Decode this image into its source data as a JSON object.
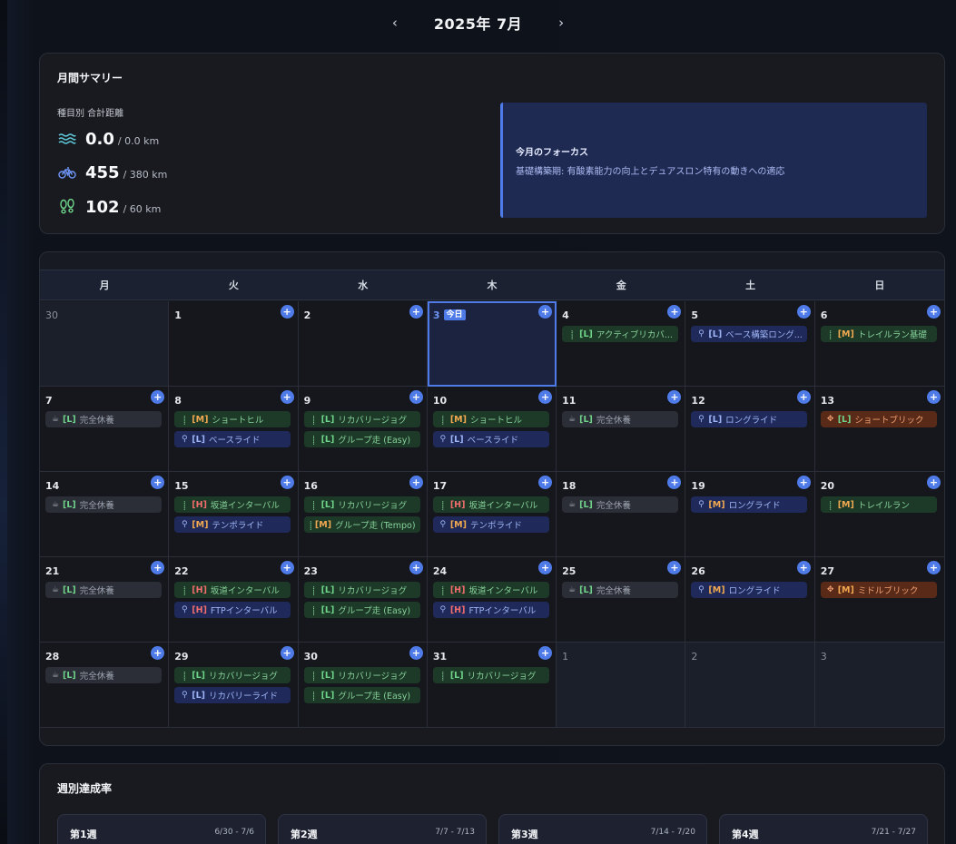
{
  "header": {
    "title": "2025年 7月",
    "prev": "‹",
    "next": "›"
  },
  "summary": {
    "title": "月間サマリー",
    "distance_label": "種目別 合計距離",
    "swim": {
      "value": "0.0",
      "target": "/ 0.0 km",
      "icon": "wave-icon"
    },
    "bike": {
      "value": "455",
      "target": "/ 380 km",
      "icon": "bike-icon"
    },
    "run": {
      "value": "102",
      "target": "/ 60 km",
      "icon": "footprints-icon"
    },
    "focus_title": "今月のフォーカス",
    "focus_text": "基礎構築期: 有酸素能力の向上とデュアスロン特有の動きへの適応"
  },
  "calendar": {
    "weekdays": [
      "月",
      "火",
      "水",
      "木",
      "金",
      "土",
      "日"
    ],
    "today_label": "今日",
    "add_label": "+",
    "days": [
      {
        "num": "30",
        "other": true,
        "events": []
      },
      {
        "num": "1",
        "events": []
      },
      {
        "num": "2",
        "events": []
      },
      {
        "num": "3",
        "today": true,
        "events": []
      },
      {
        "num": "4",
        "events": [
          {
            "type": "run",
            "level": "[L]",
            "name": "アクティブリカバ..."
          }
        ]
      },
      {
        "num": "5",
        "events": [
          {
            "type": "bike",
            "level": "[L]",
            "name": "ベース構築ロング..."
          }
        ]
      },
      {
        "num": "6",
        "events": [
          {
            "type": "run",
            "level": "[M]",
            "name": "トレイルラン基礎"
          }
        ]
      },
      {
        "num": "7",
        "events": [
          {
            "type": "rest",
            "level": "[L]",
            "name": "完全休養"
          }
        ]
      },
      {
        "num": "8",
        "events": [
          {
            "type": "run",
            "level": "[M]",
            "name": "ショートヒル"
          },
          {
            "type": "bike",
            "level": "[L]",
            "name": "ベースライド"
          }
        ]
      },
      {
        "num": "9",
        "events": [
          {
            "type": "run",
            "level": "[L]",
            "name": "リカバリージョグ"
          },
          {
            "type": "run",
            "level": "[L]",
            "name": "グループ走 (Easy)"
          }
        ]
      },
      {
        "num": "10",
        "events": [
          {
            "type": "run",
            "level": "[M]",
            "name": "ショートヒル"
          },
          {
            "type": "bike",
            "level": "[L]",
            "name": "ベースライド"
          }
        ]
      },
      {
        "num": "11",
        "events": [
          {
            "type": "rest",
            "level": "[L]",
            "name": "完全休養"
          }
        ]
      },
      {
        "num": "12",
        "events": [
          {
            "type": "bike",
            "level": "[L]",
            "name": "ロングライド"
          }
        ]
      },
      {
        "num": "13",
        "events": [
          {
            "type": "brick",
            "level": "[L]",
            "name": "ショートブリック"
          }
        ]
      },
      {
        "num": "14",
        "events": [
          {
            "type": "rest",
            "level": "[L]",
            "name": "完全休養"
          }
        ]
      },
      {
        "num": "15",
        "events": [
          {
            "type": "run",
            "level": "[H]",
            "name": "坂道インターバル"
          },
          {
            "type": "bike",
            "level": "[M]",
            "name": "テンポライド"
          }
        ]
      },
      {
        "num": "16",
        "events": [
          {
            "type": "run",
            "level": "[L]",
            "name": "リカバリージョグ"
          },
          {
            "type": "run",
            "level": "[M]",
            "name": "グループ走 (Tempo)"
          }
        ]
      },
      {
        "num": "17",
        "events": [
          {
            "type": "run",
            "level": "[H]",
            "name": "坂道インターバル"
          },
          {
            "type": "bike",
            "level": "[M]",
            "name": "テンポライド"
          }
        ]
      },
      {
        "num": "18",
        "events": [
          {
            "type": "rest",
            "level": "[L]",
            "name": "完全休養"
          }
        ]
      },
      {
        "num": "19",
        "events": [
          {
            "type": "bike",
            "level": "[M]",
            "name": "ロングライド"
          }
        ]
      },
      {
        "num": "20",
        "events": [
          {
            "type": "run",
            "level": "[M]",
            "name": "トレイルラン"
          }
        ]
      },
      {
        "num": "21",
        "events": [
          {
            "type": "rest",
            "level": "[L]",
            "name": "完全休養"
          }
        ]
      },
      {
        "num": "22",
        "events": [
          {
            "type": "run",
            "level": "[H]",
            "name": "坂道インターバル"
          },
          {
            "type": "bike",
            "level": "[H]",
            "name": "FTPインターバル"
          }
        ]
      },
      {
        "num": "23",
        "events": [
          {
            "type": "run",
            "level": "[L]",
            "name": "リカバリージョグ"
          },
          {
            "type": "run",
            "level": "[L]",
            "name": "グループ走 (Easy)"
          }
        ]
      },
      {
        "num": "24",
        "events": [
          {
            "type": "run",
            "level": "[H]",
            "name": "坂道インターバル"
          },
          {
            "type": "bike",
            "level": "[H]",
            "name": "FTPインターバル"
          }
        ]
      },
      {
        "num": "25",
        "events": [
          {
            "type": "rest",
            "level": "[L]",
            "name": "完全休養"
          }
        ]
      },
      {
        "num": "26",
        "events": [
          {
            "type": "bike",
            "level": "[M]",
            "name": "ロングライド"
          }
        ]
      },
      {
        "num": "27",
        "events": [
          {
            "type": "brick",
            "level": "[M]",
            "name": "ミドルブリック"
          }
        ]
      },
      {
        "num": "28",
        "events": [
          {
            "type": "rest",
            "level": "[L]",
            "name": "完全休養"
          }
        ]
      },
      {
        "num": "29",
        "events": [
          {
            "type": "run",
            "level": "[L]",
            "name": "リカバリージョグ"
          },
          {
            "type": "bike",
            "level": "[L]",
            "name": "リカバリーライド"
          }
        ]
      },
      {
        "num": "30",
        "events": [
          {
            "type": "run",
            "level": "[L]",
            "name": "リカバリージョグ"
          },
          {
            "type": "run",
            "level": "[L]",
            "name": "グループ走 (Easy)"
          }
        ]
      },
      {
        "num": "31",
        "events": [
          {
            "type": "run",
            "level": "[L]",
            "name": "リカバリージョグ"
          }
        ]
      },
      {
        "num": "1",
        "other": true,
        "events": []
      },
      {
        "num": "2",
        "other": true,
        "events": []
      },
      {
        "num": "3",
        "other": true,
        "events": []
      }
    ]
  },
  "weekly": {
    "title": "週別達成率",
    "weeks": [
      {
        "name": "第1週",
        "range": "6/30 - 7/6"
      },
      {
        "name": "第2週",
        "range": "7/7 - 7/13"
      },
      {
        "name": "第3週",
        "range": "7/14 - 7/20"
      },
      {
        "name": "第4週",
        "range": "7/21 - 7/27"
      }
    ]
  },
  "colors": {
    "accent": "#4f7be8",
    "run": "#1d3a28",
    "bike": "#1f2a5a",
    "brick": "#5a2a18",
    "rest": "#2b2e36"
  }
}
